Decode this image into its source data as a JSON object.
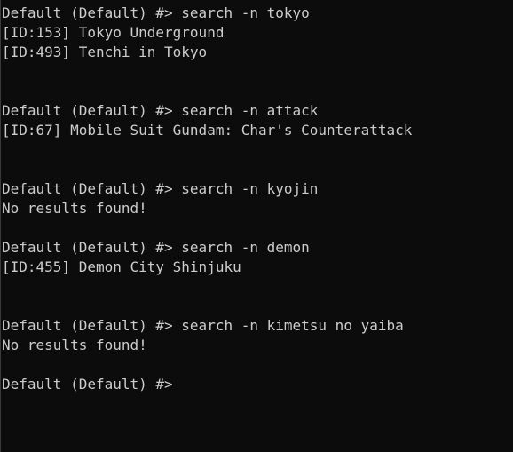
{
  "terminal": {
    "lines": [
      "Default (Default) #> search -n tokyo",
      "[ID:153] Tokyo Underground",
      "[ID:493] Tenchi in Tokyo",
      "Default (Default) #> search -n attack",
      "[ID:67] Mobile Suit Gundam: Char's Counterattack",
      "Default (Default) #> search -n kyojin",
      "No results found!",
      "Default (Default) #> search -n demon",
      "[ID:455] Demon City Shinjuku",
      "Default (Default) #> search -n kimetsu no yaiba",
      "No results found!",
      "Default (Default) #>"
    ],
    "colors": {
      "background": "#0c0c0c",
      "text": "#cccccc"
    }
  }
}
